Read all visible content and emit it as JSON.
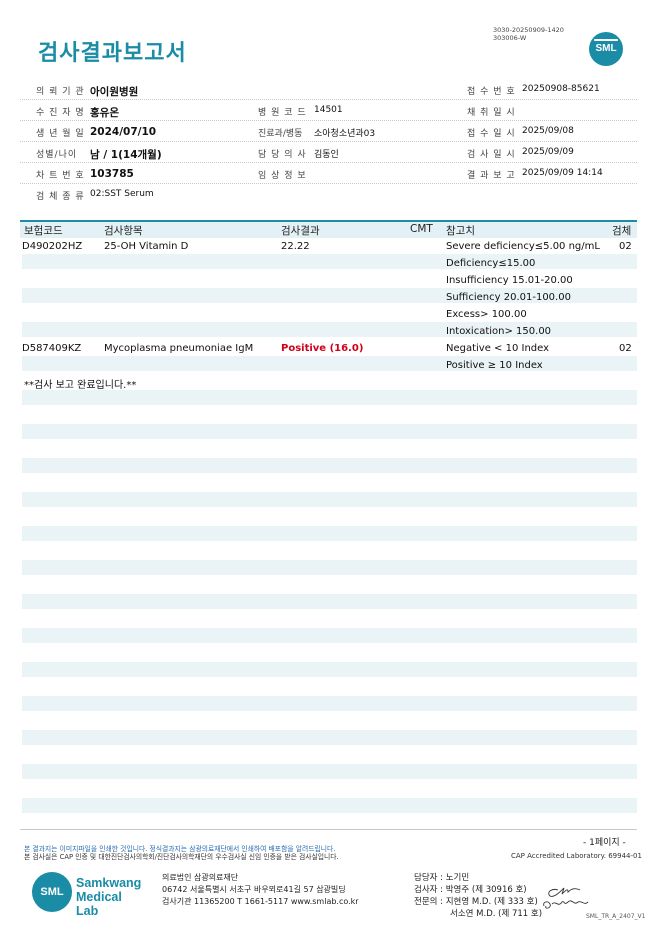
{
  "header": {
    "title": "검사결과보고서",
    "doc_code_1": "3030-20250909-1420",
    "doc_code_2": "303006-W",
    "logo": "SML"
  },
  "info": {
    "institution_label": "의 뢰 기 관",
    "institution": "아이원병원",
    "receipt_no_label": "접 수 번 호",
    "receipt_no": "20250908-85621",
    "patient_label": "수 진 자 명",
    "patient": "홍유온",
    "hospital_code_label": "병 원 코 드",
    "hospital_code": "14501",
    "collection_date_label": "채 취 일 시",
    "collection_date": "",
    "dob_label": "생 년 월 일",
    "dob": "2024/07/10",
    "department_label": "진료과/병동",
    "department": "소아청소년과03",
    "received_label": "접 수 일 시",
    "received": "2025/09/08",
    "sex_age_label": "성별/나이",
    "sex_age": "남 / 1(14개월)",
    "doctor_label": "담 당 의 사",
    "doctor": "김동인",
    "test_date_label": "검 사 일 시",
    "test_date": "2025/09/09",
    "chart_no_label": "차 트 번 호",
    "chart_no": "103785",
    "clinical_label": "임 상 정 보",
    "clinical": "",
    "report_label": "결 과 보 고",
    "report": "2025/09/09 14:14",
    "specimen_label": "검 체 종 류",
    "specimen": "02:SST Serum"
  },
  "table": {
    "headers": {
      "code": "보험코드",
      "item": "검사항목",
      "result": "검사결과",
      "cmt": "CMT",
      "reference": "참고치",
      "specimen": "검체"
    },
    "rows": [
      {
        "code": "D490202HZ",
        "item": "25-OH Vitamin D",
        "result": "22.22",
        "reference": "Severe deficiency≤5.00 ng/mL",
        "specimen": "02"
      },
      {
        "reference": "Deficiency≤15.00"
      },
      {
        "reference": "Insufficiency 15.01-20.00"
      },
      {
        "reference": "Sufficiency 20.01-100.00"
      },
      {
        "reference": "Excess> 100.00"
      },
      {
        "reference": "Intoxication> 150.00"
      },
      {
        "code": "D587409KZ",
        "item": "Mycoplasma pneumoniae IgM",
        "result": "Positive (16.0)",
        "reference": "Negative < 10 Index",
        "specimen": "02"
      },
      {
        "reference": "Positive ≥ 10 Index"
      }
    ],
    "completion": "**검사 보고 완료입니다.**"
  },
  "footer": {
    "notice_1": "본 결과지는 이미지파일을 인쇄한 것입니다. 정식결과지는 삼광의료재단에서 인쇄하여 배포함을 알려드립니다.",
    "notice_2": "본 검사실은 CAP 인증 및 대한진단검사의학회/진단검사의학재단의 우수검사실 신임 인증을 받은 검사실입니다.",
    "page": "- 1페이지 -",
    "cap": "CAP Accredited Laboratory. 69944-01",
    "logo_sml": "SML",
    "logo_name_1": "Samkwang",
    "logo_name_2": "Medical Lab",
    "org": "의료법인 삼광의료재단",
    "address": "06742 서울특별시 서초구 바우뫼로41길 57 삼광빌딩",
    "contact": "검사기관 11365200 T 1661-5117 www.smlab.co.kr",
    "manager": "담당자 :  노기민",
    "examiner": "검사자 :  박영주 (제 30916 호)",
    "specialist_1": "전문의 :  지현영 M.D. (제 333 호)",
    "specialist_2": "서소연 M.D. (제 711 호)",
    "form_code": "SML_TR_A_2407_V1"
  }
}
